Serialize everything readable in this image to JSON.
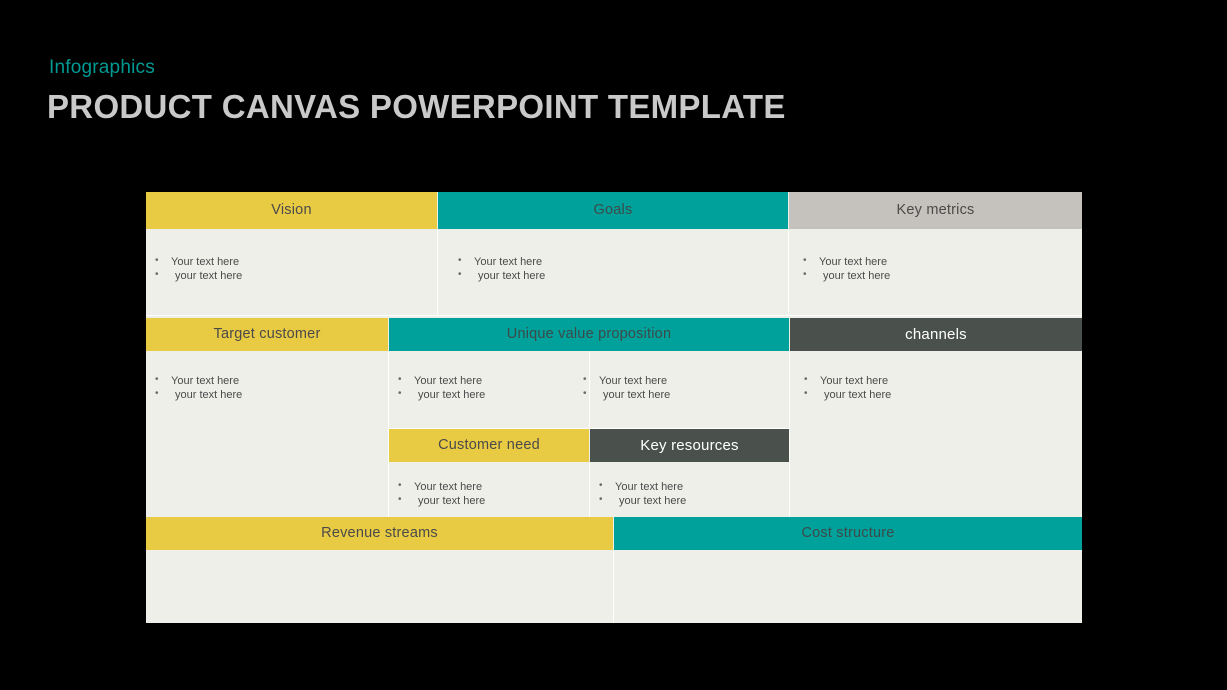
{
  "header": {
    "eyebrow": "Infographics",
    "title": "PRODUCT CANVAS POWERPOINT TEMPLATE"
  },
  "colors": {
    "background": "#000000",
    "yellow": "#E8CA43",
    "teal": "#00A19A",
    "light_gray": "#C5C1BC",
    "dark_gray": "#4A514C",
    "panel": "#EFEFEA",
    "title_text": "#C9C9C9",
    "eyebrow_text": "#009A93",
    "body_text": "#4A4A4A"
  },
  "bullets": {
    "line1": "Your text here",
    "line2": "your text here"
  },
  "canvas": {
    "row1": [
      {
        "label": "Vision",
        "style": "yellow"
      },
      {
        "label": "Goals",
        "style": "teal"
      },
      {
        "label": "Key metrics",
        "style": "gray"
      }
    ],
    "row2": [
      {
        "label": "Target customer",
        "style": "yellow"
      },
      {
        "label": "Unique  value proposition",
        "style": "teal"
      },
      {
        "label": "channels",
        "style": "dark"
      }
    ],
    "row2_sub": [
      {
        "label": "Customer need",
        "style": "yellow"
      },
      {
        "label": "Key resources",
        "style": "dark"
      }
    ],
    "row3": [
      {
        "label": "Revenue  streams",
        "style": "yellow"
      },
      {
        "label": "Cost structure",
        "style": "teal"
      }
    ]
  }
}
